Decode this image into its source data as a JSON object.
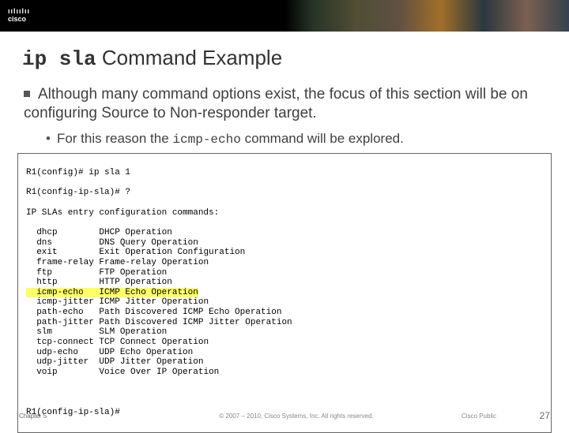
{
  "brand": {
    "name": "cisco",
    "bars": "ıılıılıı"
  },
  "title": {
    "cmd": "ip sla",
    "rest": " Command Example"
  },
  "bullet": "Although many command options exist, the focus of this section will be on configuring Source to Non-responder target.",
  "sub_bullet": {
    "pre": "For this reason the ",
    "cmd": "icmp-echo",
    "post": " command will be explored."
  },
  "term": {
    "line1": "R1(config)# ip sla 1",
    "line2": "R1(config-ip-sla)# ?",
    "line3": "IP SLAs entry configuration commands:",
    "rows": [
      {
        "opt": "dhcp",
        "desc": "DHCP Operation",
        "hl": false
      },
      {
        "opt": "dns",
        "desc": "DNS Query Operation",
        "hl": false
      },
      {
        "opt": "exit",
        "desc": "Exit Operation Configuration",
        "hl": false
      },
      {
        "opt": "frame-relay",
        "desc": "Frame-relay Operation",
        "hl": false
      },
      {
        "opt": "ftp",
        "desc": "FTP Operation",
        "hl": false
      },
      {
        "opt": "http",
        "desc": "HTTP Operation",
        "hl": false
      },
      {
        "opt": "icmp-echo",
        "desc": "ICMP Echo Operation",
        "hl": true
      },
      {
        "opt": "icmp-jitter",
        "desc": "ICMP Jitter Operation",
        "hl": false
      },
      {
        "opt": "path-echo",
        "desc": "Path Discovered ICMP Echo Operation",
        "hl": false
      },
      {
        "opt": "path-jitter",
        "desc": "Path Discovered ICMP Jitter Operation",
        "hl": false
      },
      {
        "opt": "slm",
        "desc": "SLM Operation",
        "hl": false
      },
      {
        "opt": "tcp-connect",
        "desc": "TCP Connect Operation",
        "hl": false
      },
      {
        "opt": "udp-echo",
        "desc": "UDP Echo Operation",
        "hl": false
      },
      {
        "opt": "udp-jitter",
        "desc": "UDP Jitter Operation",
        "hl": false
      },
      {
        "opt": "voip",
        "desc": "Voice Over IP Operation",
        "hl": false
      }
    ],
    "prompt_end": "R1(config-ip-sla)#"
  },
  "footer": {
    "chapter": "Chapter 5",
    "copyright": "© 2007 – 2010, Cisco Systems, Inc. All rights reserved.",
    "public": "Cisco Public",
    "page": "27"
  }
}
